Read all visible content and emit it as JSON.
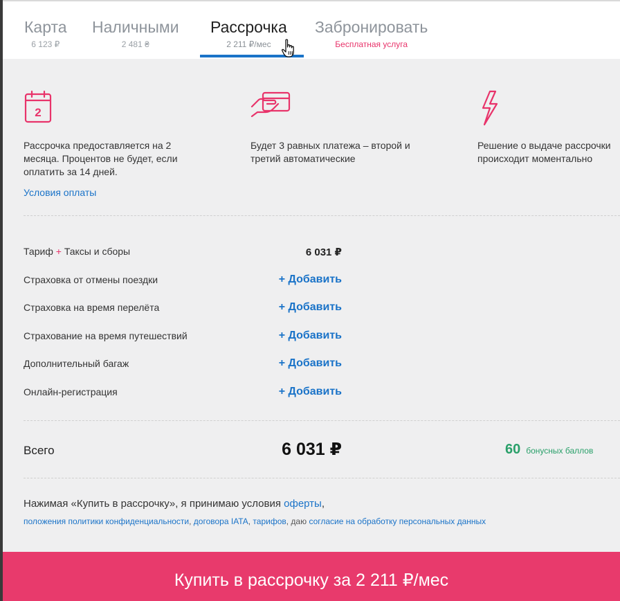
{
  "tabs": [
    {
      "label": "Карта",
      "sub": "6 123 ₽"
    },
    {
      "label": "Наличными",
      "sub": "2 481 ₴"
    },
    {
      "label": "Рассрочка",
      "sub": "2 211 ₽/мес"
    },
    {
      "label": "Забронировать",
      "sub": "Бесплатная услуга"
    }
  ],
  "active_tab": "Рассрочка",
  "features": [
    {
      "icon": "calendar-icon",
      "calendar_day": "2",
      "text": "Рассрочка предоставляется на 2 месяца. Процентов не будет, если оплатить за 14 дней.",
      "link": "Условия оплаты"
    },
    {
      "icon": "hand-card-icon",
      "text": "Будет 3 равных платежа – второй и третий автоматические"
    },
    {
      "icon": "lightning-icon",
      "text": "Решение о выдаче рассрочки происходит моментально"
    }
  ],
  "price_rows": {
    "fare": {
      "label_a": "Тариф",
      "plus": "+",
      "label_b": "Таксы и сборы",
      "value": "6 031 ₽"
    },
    "add_label": "+ Добавить",
    "extras": [
      "Страховка от отмены поездки",
      "Страховка на время перелёта",
      "Страхование на время путешествий",
      "Дополнительный багаж",
      "Онлайн-регистрация"
    ]
  },
  "total": {
    "label": "Всего",
    "value": "6 031 ₽",
    "bonus_points": "60",
    "bonus_label": "бонусных баллов"
  },
  "legal": {
    "line1_text": "Нажимая «Купить в рассрочку», я принимаю условия ",
    "line1_link": "оферты",
    "line1_end": ",",
    "line2_link1": "положения политики конфиденциальности",
    "sep1": ", ",
    "line2_link2": "договора IATA",
    "sep2": ", ",
    "line2_link3": "тарифов",
    "sep3": ", даю ",
    "line2_link4": "согласие на обработку персональных данных"
  },
  "buy_button": "Купить в рассрочку за 2 211 ₽/мес",
  "colors": {
    "accent": "#e83a6c",
    "link": "#1a73c8",
    "bonus": "#2aa06a"
  }
}
